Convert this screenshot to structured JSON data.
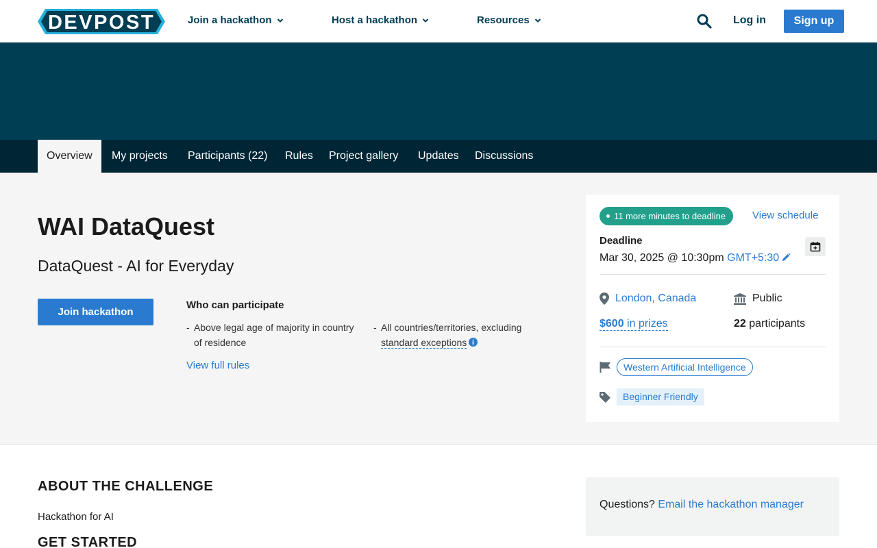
{
  "nav": {
    "logo_text": "DEVPOST",
    "join": "Join a hackathon",
    "host": "Host a hackathon",
    "resources": "Resources",
    "login": "Log in",
    "signup": "Sign up"
  },
  "tabs": [
    {
      "label": "Overview"
    },
    {
      "label": "My projects"
    },
    {
      "label": "Participants (22)"
    },
    {
      "label": "Rules"
    },
    {
      "label": "Project gallery"
    },
    {
      "label": "Updates"
    },
    {
      "label": "Discussions"
    }
  ],
  "hero": {
    "title": "WAI DataQuest",
    "subtitle": "DataQuest - AI for Everyday",
    "join_button": "Join hackathon",
    "who_title": "Who can participate",
    "eligibility": [
      {
        "line1": "Above legal age of majority in country",
        "line2": "of residence"
      },
      {
        "line1": "All countries/territories, excluding",
        "line2": "standard exceptions"
      }
    ],
    "full_rules": "View full rules"
  },
  "sidebar": {
    "deadline_pill": "11 more minutes to deadline",
    "view_schedule": "View schedule",
    "deadline_label": "Deadline",
    "deadline_value": "Mar 30, 2025 @ 10:30pm",
    "timezone": "GMT+5:30",
    "location": "London, Canada",
    "visibility": "Public",
    "prize_amount": "$600",
    "prize_suffix": "in prizes",
    "participant_count": "22",
    "participant_label": "participants",
    "host": "Western Artificial Intelligence",
    "theme": "Beginner Friendly"
  },
  "lower": {
    "about_heading": "ABOUT THE CHALLENGE",
    "about_text": "Hackathon for AI",
    "started_heading": "GET STARTED",
    "questions_label": "Questions?",
    "questions_link": "Email the hackathon manager"
  },
  "colors": {
    "brand_dark": "#003e54",
    "tab_bar": "#002636",
    "primary_blue": "#2a7bd0",
    "deadline_green": "#23a08c",
    "logo_cyan": "#26b0d9"
  }
}
